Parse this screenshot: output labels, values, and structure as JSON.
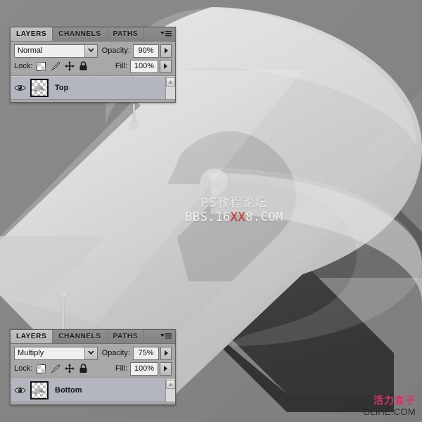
{
  "app": {
    "background_color": "#878787"
  },
  "artwork": {
    "description": "isometric extruded glossy number-2 shape",
    "top_face_color": "#d2d2d2",
    "side_face_color": "#9a9a9a",
    "shadow_color": "#4a4a4a"
  },
  "watermark": {
    "line_cn": "PS教程论坛",
    "line_en_prefix": "BBS.16",
    "line_en_highlight": "XX",
    "line_en_suffix": "8.COM",
    "highlight_color": "#d02a2a"
  },
  "logo": {
    "brand_cn": "活力盒子",
    "brand_en": "OLiHE.COM",
    "brand_color": "#d8326a"
  },
  "panels": [
    {
      "id": "top",
      "tabs": [
        {
          "label": "LAYERS",
          "active": true
        },
        {
          "label": "CHANNELS",
          "active": false
        },
        {
          "label": "PATHS",
          "active": false
        }
      ],
      "menu_icon": "panel-menu-icon",
      "blend_mode": "Normal",
      "opacity_label": "Opacity:",
      "opacity_value": "90%",
      "lock_label": "Lock:",
      "lock_icons": [
        "lock-transparency-icon",
        "lock-pixels-icon",
        "lock-position-icon",
        "lock-all-icon"
      ],
      "fill_label": "Fill:",
      "fill_value": "100%",
      "layer": {
        "visibility_icon": "eye-icon",
        "thumbnail_icon": "layer-thumbnail",
        "name": "Top",
        "selected": true
      }
    },
    {
      "id": "bottom",
      "tabs": [
        {
          "label": "LAYERS",
          "active": true
        },
        {
          "label": "CHANNELS",
          "active": false
        },
        {
          "label": "PATHS",
          "active": false
        }
      ],
      "menu_icon": "panel-menu-icon",
      "blend_mode": "Multiply",
      "opacity_label": "Opacity:",
      "opacity_value": "75%",
      "lock_label": "Lock:",
      "lock_icons": [
        "lock-transparency-icon",
        "lock-pixels-icon",
        "lock-position-icon",
        "lock-all-icon"
      ],
      "fill_label": "Fill:",
      "fill_value": "100%",
      "layer": {
        "visibility_icon": "eye-icon",
        "thumbnail_icon": "layer-thumbnail",
        "name": "Bottom",
        "selected": true
      }
    }
  ]
}
